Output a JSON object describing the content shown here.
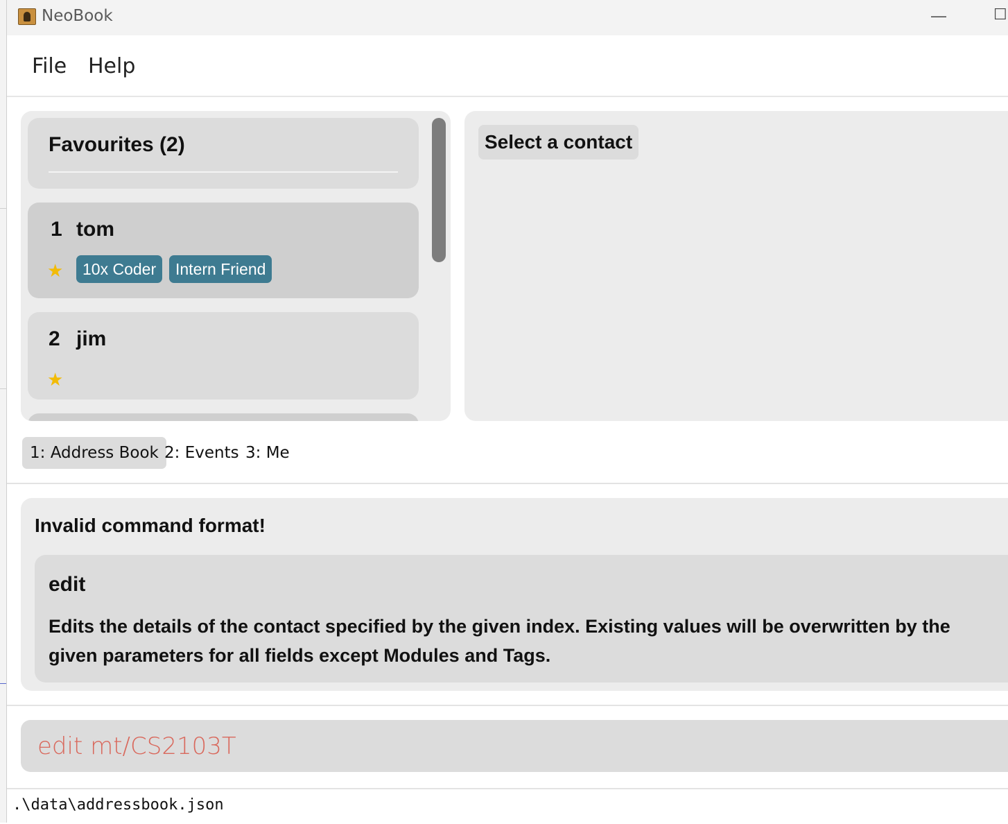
{
  "window": {
    "title": "NeoBook",
    "minimize_glyph": "—",
    "maximize_glyph": "☐"
  },
  "menu": {
    "file": "File",
    "help": "Help"
  },
  "favourites": {
    "title": "Favourites (2)"
  },
  "contacts": [
    {
      "index": "1",
      "name": "tom",
      "tags": [
        "10x Coder",
        "Intern Friend"
      ],
      "favourite": true,
      "selected": true
    },
    {
      "index": "2",
      "name": "jim",
      "tags": [],
      "favourite": true,
      "selected": false
    }
  ],
  "icons": {
    "star": "★",
    "app": "address-book-icon"
  },
  "detail": {
    "placeholder": "Select a contact"
  },
  "tabs": [
    {
      "label": "1: Address Book",
      "active": true
    },
    {
      "label": "2: Events",
      "active": false
    },
    {
      "label": "3: Me",
      "active": false
    }
  ],
  "result": {
    "title": "Invalid command format!",
    "command": "edit",
    "description": "Edits the details of the contact specified by the given index. Existing values will be overwritten by the given parameters for all fields except Modules and Tags."
  },
  "command_box": {
    "value": "edit mt/CS2103T"
  },
  "status": {
    "path": ".\\data\\addressbook.json"
  },
  "colors": {
    "tag": "#3e7b91",
    "star": "#f2bb07",
    "command_error": "#d9685c",
    "panel": "#ececec",
    "card": "#dcdcdc"
  }
}
